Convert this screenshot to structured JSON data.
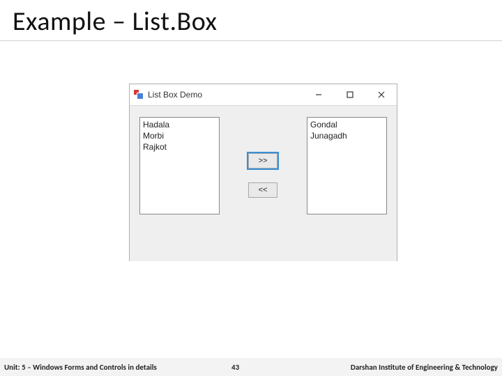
{
  "slide_title": "Example – List.Box",
  "window": {
    "title": "List Box Demo",
    "buttons": {
      "forward": ">>",
      "back": "<<"
    },
    "left_list": [
      "Hadala",
      "Morbi",
      "Rajkot"
    ],
    "right_list": [
      "Gondal",
      "Junagadh"
    ]
  },
  "footer": {
    "unit": "Unit: 5 – Windows Forms and Controls in details",
    "page": "43",
    "org": "Darshan Institute of Engineering & Technology"
  }
}
